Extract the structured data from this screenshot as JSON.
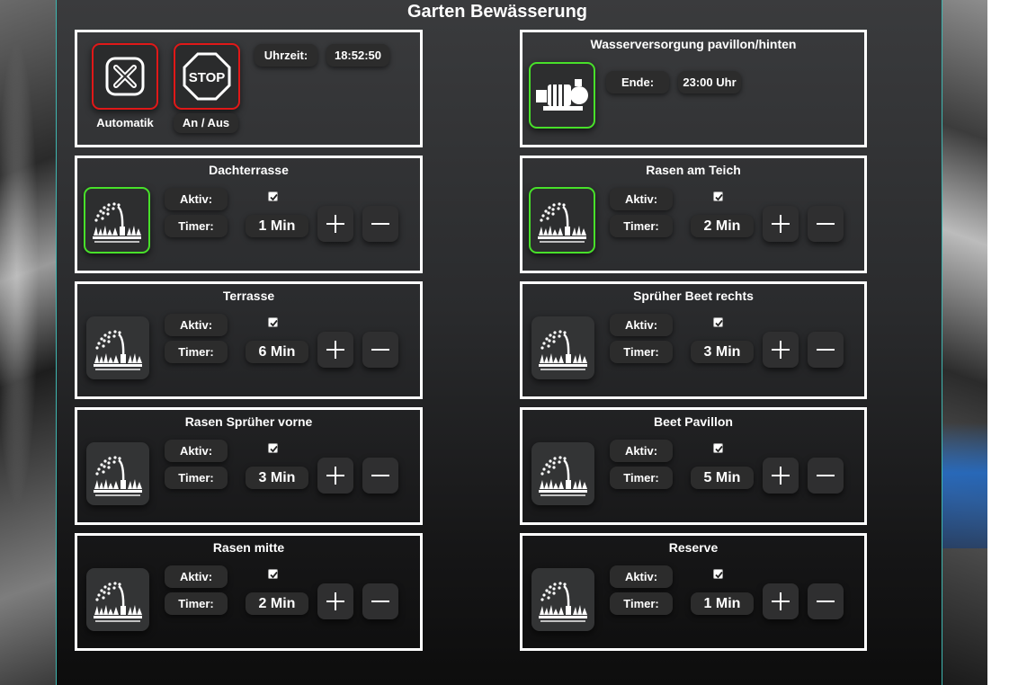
{
  "page": {
    "title": "Garten Bewässerung"
  },
  "colors": {
    "active_border": "#48e02a",
    "alarm_border": "#e01818",
    "panel_edge": "#3fb6b0",
    "card_border": "#ffffff"
  },
  "control": {
    "automatik": {
      "label": "Automatik",
      "icon": "close-x-icon"
    },
    "anaus": {
      "label": "An / Aus",
      "icon": "stop-sign-icon"
    },
    "uhrzeit_label": "Uhrzeit:",
    "uhrzeit_value": "18:52:50"
  },
  "wasser": {
    "title": "Wasserversorgung pavillon/hinten",
    "icon": "water-pump-icon",
    "ende_label": "Ende:",
    "ende_value": "23:00 Uhr"
  },
  "labels": {
    "aktiv": "Aktiv:",
    "timer": "Timer:"
  },
  "zones": [
    {
      "name": "Dachterrasse",
      "timer": "1 Min",
      "aktiv": true,
      "running": true
    },
    {
      "name": "Rasen am Teich",
      "timer": "2 Min",
      "aktiv": true,
      "running": true
    },
    {
      "name": "Terrasse",
      "timer": "6 Min",
      "aktiv": true,
      "running": false
    },
    {
      "name": "Sprüher Beet rechts",
      "timer": "3 Min",
      "aktiv": true,
      "running": false
    },
    {
      "name": "Rasen Sprüher vorne",
      "timer": "3 Min",
      "aktiv": true,
      "running": false
    },
    {
      "name": "Beet Pavillon",
      "timer": "5 Min",
      "aktiv": true,
      "running": false
    },
    {
      "name": "Rasen mitte",
      "timer": "2 Min",
      "aktiv": true,
      "running": false
    },
    {
      "name": "Reserve",
      "timer": "1 Min",
      "aktiv": true,
      "running": false
    }
  ]
}
